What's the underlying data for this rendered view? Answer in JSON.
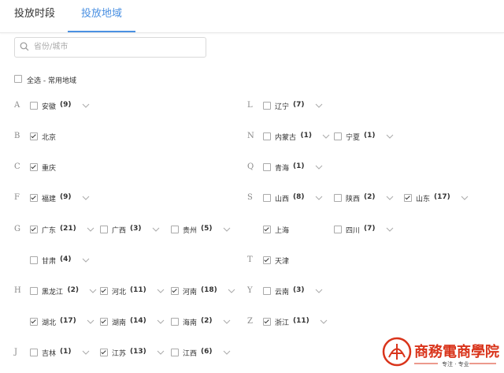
{
  "tabs": [
    "投放时段",
    "投放地域"
  ],
  "search": {
    "placeholder": "省份/城市"
  },
  "select_all": {
    "label": "全选 - 常用地域",
    "checked": false
  },
  "letters": [
    "A",
    "B",
    "C",
    "F",
    "G",
    "H",
    "J",
    "L",
    "N",
    "Q",
    "S",
    "T",
    "Y",
    "Z"
  ],
  "regions": [
    {
      "name": "安徽",
      "count": "(9)",
      "checked": false
    },
    {
      "name": "北京",
      "count": "",
      "checked": true
    },
    {
      "name": "重庆",
      "count": "",
      "checked": true
    },
    {
      "name": "福建",
      "count": "(9)",
      "checked": true
    },
    {
      "name": "广东",
      "count": "(21)",
      "checked": true
    },
    {
      "name": "广西",
      "count": "(3)",
      "checked": false
    },
    {
      "name": "贵州",
      "count": "(5)",
      "checked": false
    },
    {
      "name": "甘肃",
      "count": "(4)",
      "checked": false
    },
    {
      "name": "黑龙江",
      "count": "(2)",
      "checked": false
    },
    {
      "name": "河北",
      "count": "(11)",
      "checked": true
    },
    {
      "name": "河南",
      "count": "(18)",
      "checked": true
    },
    {
      "name": "湖北",
      "count": "(17)",
      "checked": true
    },
    {
      "name": "湖南",
      "count": "(14)",
      "checked": true
    },
    {
      "name": "海南",
      "count": "(2)",
      "checked": false
    },
    {
      "name": "吉林",
      "count": "(1)",
      "checked": false
    },
    {
      "name": "江苏",
      "count": "(13)",
      "checked": true
    },
    {
      "name": "江西",
      "count": "(6)",
      "checked": false
    },
    {
      "name": "辽宁",
      "count": "(7)",
      "checked": false
    },
    {
      "name": "内蒙古",
      "count": "(1)",
      "checked": false
    },
    {
      "name": "宁夏",
      "count": "(1)",
      "checked": false
    },
    {
      "name": "青海",
      "count": "(1)",
      "checked": false
    },
    {
      "name": "山西",
      "count": "(8)",
      "checked": false
    },
    {
      "name": "陕西",
      "count": "(2)",
      "checked": false
    },
    {
      "name": "山东",
      "count": "(17)",
      "checked": true
    },
    {
      "name": "上海",
      "count": "",
      "checked": true
    },
    {
      "name": "四川",
      "count": "(7)",
      "checked": false
    },
    {
      "name": "天津",
      "count": "",
      "checked": true
    },
    {
      "name": "云南",
      "count": "(3)",
      "checked": false
    },
    {
      "name": "浙江",
      "count": "(11)",
      "checked": true
    }
  ],
  "watermark": {
    "title": "商務電商學院",
    "subtitle": "专注 · 专业"
  },
  "colors": {
    "accent": "#4a90e2",
    "logo": "#d9341b"
  },
  "icons": {
    "search": "search-icon",
    "expand": "chevron-down-icon"
  }
}
